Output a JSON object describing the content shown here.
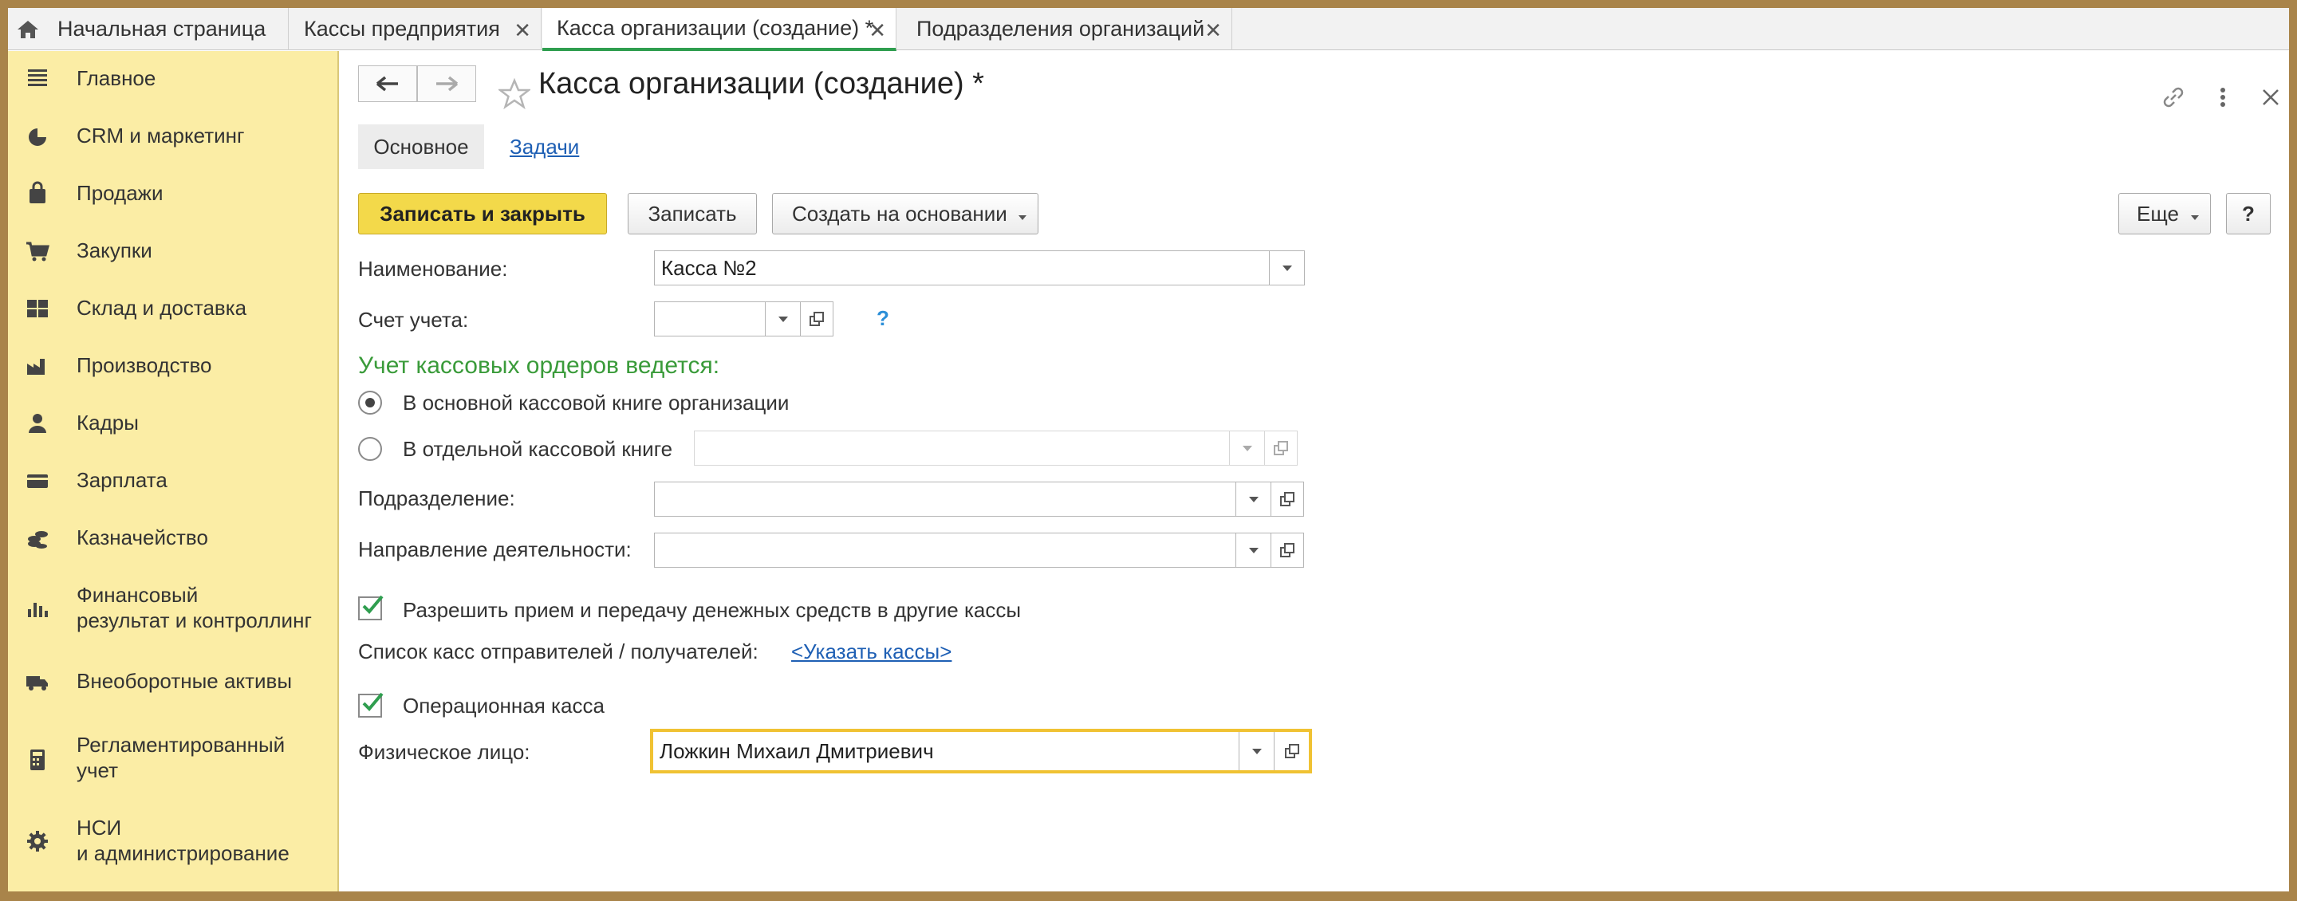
{
  "tabs": [
    {
      "label": "Начальная страница"
    },
    {
      "label": "Кассы предприятия"
    },
    {
      "label": "Касса организации (создание) *"
    },
    {
      "label": "Подразделения организаций"
    }
  ],
  "sidebar": {
    "items": [
      {
        "label": "Главное",
        "icon": "menu-icon"
      },
      {
        "label": "CRM и маркетинг",
        "icon": "pie-chart-icon"
      },
      {
        "label": "Продажи",
        "icon": "shopping-bag-icon"
      },
      {
        "label": "Закупки",
        "icon": "cart-icon"
      },
      {
        "label": "Склад и доставка",
        "icon": "warehouse-icon"
      },
      {
        "label": "Производство",
        "icon": "factory-icon"
      },
      {
        "label": "Кадры",
        "icon": "person-icon"
      },
      {
        "label": "Зарплата",
        "icon": "card-icon"
      },
      {
        "label": "Казначейство",
        "icon": "coins-icon"
      },
      {
        "label": "Финансовый\nрезультат и контроллинг",
        "line1": "Финансовый",
        "line2": "результат и контроллинг",
        "icon": "bar-chart-icon"
      },
      {
        "label": "Внеоборотные активы",
        "icon": "truck-icon"
      },
      {
        "label": "Регламентированный\nучет",
        "line1": "Регламентированный",
        "line2": "учет",
        "icon": "calculator-icon"
      },
      {
        "label": "НСИ\nи администрирование",
        "line1": "НСИ",
        "line2": "и администрирование",
        "icon": "gear-icon"
      }
    ]
  },
  "header": {
    "title": "Касса организации (создание) *",
    "form_tabs": [
      "Основное",
      "Задачи"
    ]
  },
  "toolbar": {
    "save_close": "Записать и закрыть",
    "save": "Записать",
    "create_based": "Создать на основании",
    "more": "Еще",
    "help": "?"
  },
  "form": {
    "name_label": "Наименование:",
    "name_value": "Касса №2",
    "account_label": "Счет учета:",
    "account_value": "",
    "account_hint": "?",
    "orders_heading": "Учет кассовых ордеров ведется:",
    "radio_main": "В основной кассовой книге организации",
    "radio_separate": "В отдельной кассовой книге",
    "radio_selected": "main",
    "dept_label": "Подразделение:",
    "dept_value": "",
    "activity_label": "Направление деятельности:",
    "activity_value": "",
    "allow_transfer_label": "Разрешить прием и передачу денежных средств в другие кассы",
    "allow_transfer_checked": true,
    "cash_list_label": "Список касс отправителей / получателей:",
    "cash_list_link": "<Указать кассы>",
    "operational_label": "Операционная касса",
    "operational_checked": true,
    "person_label": "Физическое лицо:",
    "person_value": "Ложкин Михаил Дмитриевич"
  },
  "colors": {
    "sidebar_bg": "#fbeda5",
    "primary_button": "#f3d94a",
    "section_heading": "#3a9b3a",
    "link": "#1e5fb4",
    "active_tab_underline": "#2f9e4f",
    "focus_border": "#f0c233"
  }
}
